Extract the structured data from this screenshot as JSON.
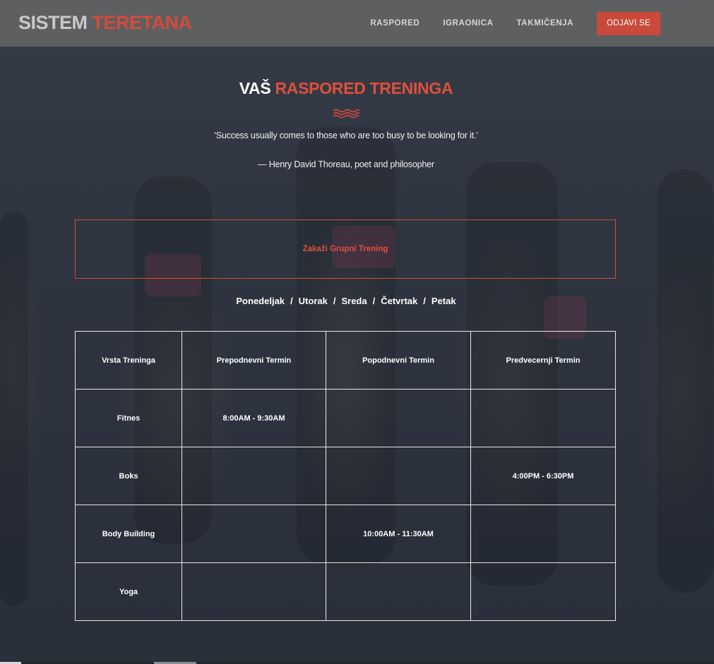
{
  "header": {
    "logo_part1": "SISTEM",
    "logo_part2": "TERETANA",
    "nav": [
      "RASPORED",
      "IGRAONICA",
      "TAKMIČENJA"
    ],
    "logout_label": "ODJAVI SE"
  },
  "hero": {
    "title_white": "VAŠ",
    "title_red": "RASPORED TRENINGA",
    "quote": "‘Success usually comes to those who are too busy to be looking for it.’",
    "author": "— Henry David Thoreau, poet and philosopher"
  },
  "booking": {
    "label": "Zakaži Grupni Trening"
  },
  "days": [
    "Ponedeljak",
    "Utorak",
    "Sreda",
    "Četvrtak",
    "Petak"
  ],
  "days_separator": "/",
  "table": {
    "headers": [
      "Vrsta Treninga",
      "Prepodnevni Termin",
      "Popodnevni Termin",
      "Predvecernji Termin"
    ],
    "rows": [
      [
        "Fitnes",
        "8:00AM - 9:30AM",
        "",
        ""
      ],
      [
        "Boks",
        "",
        "",
        "4:00PM - 6:30PM"
      ],
      [
        "Body Building",
        "",
        "10:00AM - 11:30AM",
        ""
      ],
      [
        "Yoga",
        "",
        "",
        ""
      ]
    ]
  },
  "colors": {
    "accent": "#d44b3a",
    "header_bg": "#5e5f61",
    "page_bg": "#2b3340"
  }
}
